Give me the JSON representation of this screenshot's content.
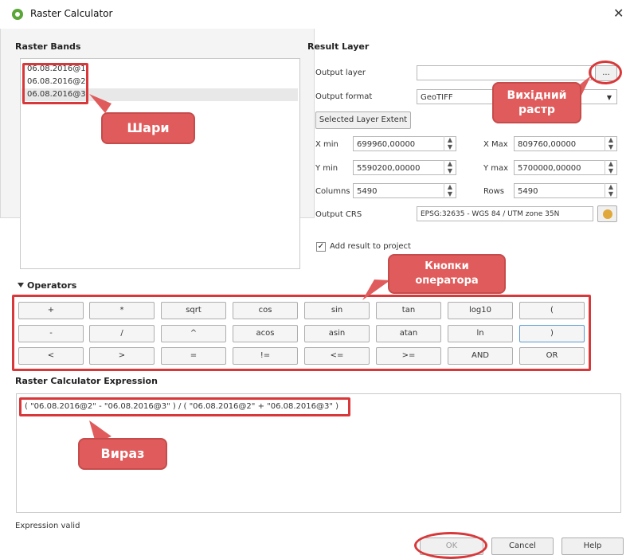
{
  "window": {
    "title": "Raster Calculator",
    "close": "✕"
  },
  "raster_bands": {
    "title": "Raster Bands",
    "items": [
      "06.08.2016@1",
      "06.08.2016@2",
      "06.08.2016@3"
    ]
  },
  "result_layer": {
    "title": "Result Layer",
    "output_layer_label": "Output layer",
    "output_layer_value": "",
    "browse_label": "...",
    "output_format_label": "Output format",
    "output_format_value": "GeoTIFF",
    "selected_extent_button": "Selected Layer Extent",
    "xmin_label": "X min",
    "xmin_value": "699960,00000",
    "xmax_label": "X Max",
    "xmax_value": "809760,00000",
    "ymin_label": "Y min",
    "ymin_value": "5590200,00000",
    "ymax_label": "Y max",
    "ymax_value": "5700000,00000",
    "columns_label": "Columns",
    "columns_value": "5490",
    "rows_label": "Rows",
    "rows_value": "5490",
    "crs_label": "Output CRS",
    "crs_value": "EPSG:32635 - WGS 84 / UTM zone 35N",
    "add_result_label": "Add result to project",
    "add_result_checked": "✓"
  },
  "operators": {
    "title": "Operators",
    "row1": [
      "+",
      "*",
      "sqrt",
      "cos",
      "sin",
      "tan",
      "log10",
      "("
    ],
    "row2": [
      "-",
      "/",
      "^",
      "acos",
      "asin",
      "atan",
      "ln",
      ")"
    ],
    "row3": [
      "<",
      ">",
      "=",
      "!=",
      "<=",
      ">=",
      "AND",
      "OR"
    ]
  },
  "expression": {
    "title": "Raster Calculator Expression",
    "value": "( \"06.08.2016@2\" - \"06.08.2016@3\" ) / ( \"06.08.2016@2\" + \"06.08.2016@3\" )",
    "status": "Expression valid"
  },
  "buttons": {
    "ok": "OK",
    "cancel": "Cancel",
    "help": "Help"
  },
  "annotations": {
    "layers": "Шари",
    "output_raster_line1": "Вихідний",
    "output_raster_line2": "растр",
    "operator_buttons_line1": "Кнопки",
    "operator_buttons_line2": "оператора",
    "expression": "Вираз"
  },
  "colors": {
    "annotation_red": "#d9383a",
    "callout_fill": "#e05c5c"
  }
}
